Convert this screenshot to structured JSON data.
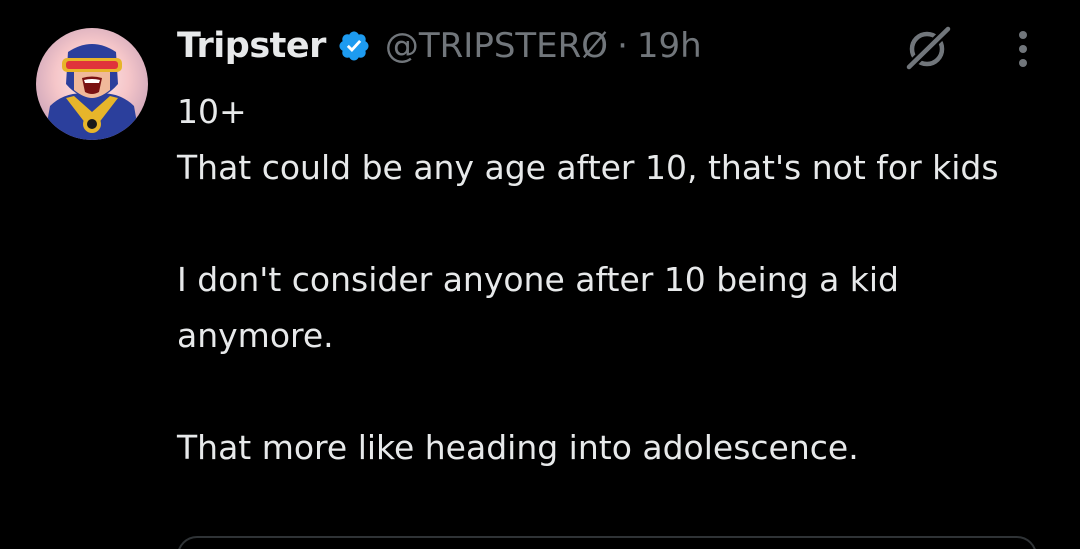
{
  "post": {
    "author": {
      "display_name": "Tripster",
      "handle": "@TRIPSTERØ",
      "verified": true,
      "avatar_icon": "cyclops-avatar"
    },
    "separator": "·",
    "time": "19h",
    "icons": {
      "grok": "grok-icon",
      "more": "more-options-icon",
      "verified": "verified-badge-icon"
    },
    "body": {
      "line1": "10+",
      "line2": "That could be any age after 10, that's not for kids",
      "paragraph2": "I don't consider anyone after 10 being a kid anymore.",
      "paragraph3": "That more like heading into adolescence."
    }
  },
  "colors": {
    "background": "#000000",
    "primary_text": "#e7e9ea",
    "secondary_text": "#71767b",
    "verified_blue": "#1d9bf0"
  }
}
